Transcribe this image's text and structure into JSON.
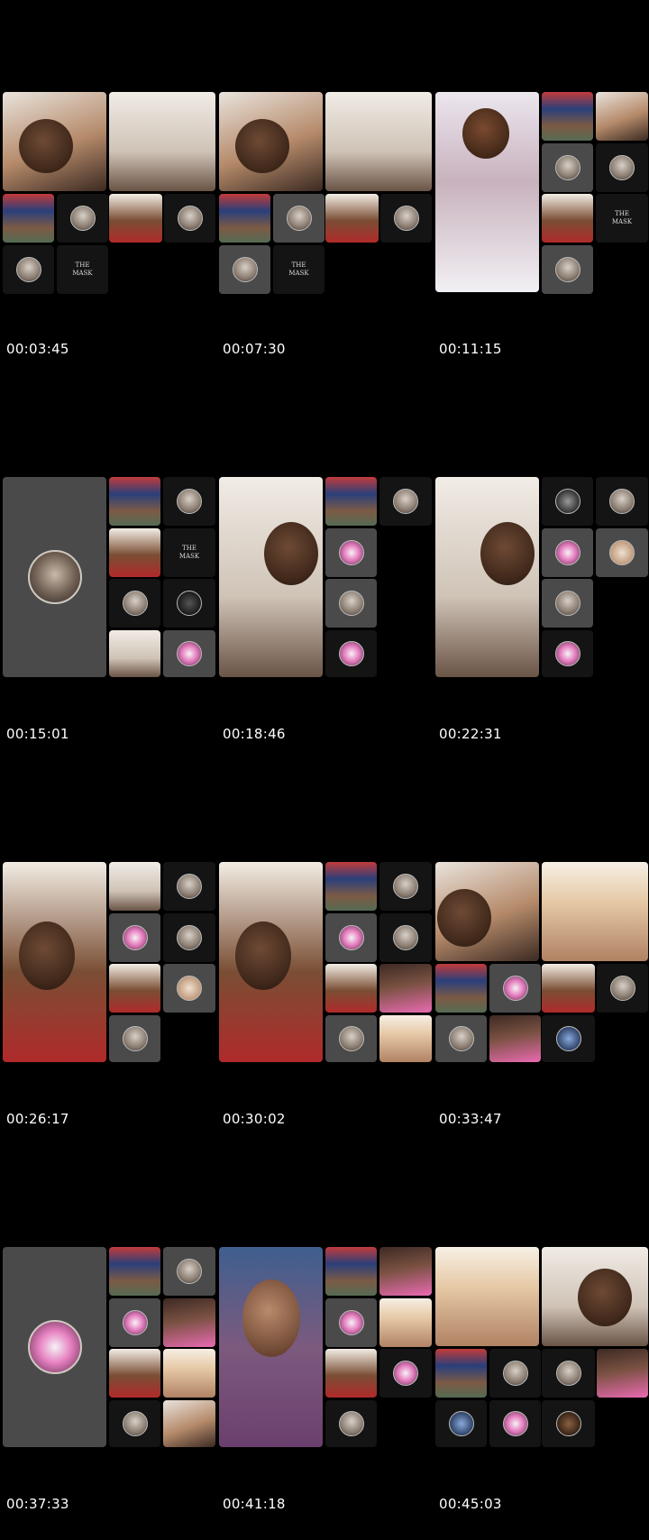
{
  "contact_sheet": {
    "cells": [
      {
        "timestamp": "00:03:45",
        "layout": "a"
      },
      {
        "timestamp": "00:07:30",
        "layout": "b"
      },
      {
        "timestamp": "00:11:15",
        "layout": "c"
      },
      {
        "timestamp": "00:15:01",
        "layout": "d"
      },
      {
        "timestamp": "00:18:46",
        "layout": "e"
      },
      {
        "timestamp": "00:22:31",
        "layout": "e"
      },
      {
        "timestamp": "00:26:17",
        "layout": "f"
      },
      {
        "timestamp": "00:30:02",
        "layout": "f"
      },
      {
        "timestamp": "00:33:47",
        "layout": "g"
      },
      {
        "timestamp": "00:37:33",
        "layout": "h"
      },
      {
        "timestamp": "00:41:18",
        "layout": "i"
      },
      {
        "timestamp": "00:45:03",
        "layout": "g"
      }
    ],
    "mask_logo_text": "THE MASK"
  },
  "colors": {
    "background": "#000000",
    "timestamp_text": "#ffffff",
    "tile_dark": "#141414",
    "tile_grey": "#4a4a4a"
  }
}
